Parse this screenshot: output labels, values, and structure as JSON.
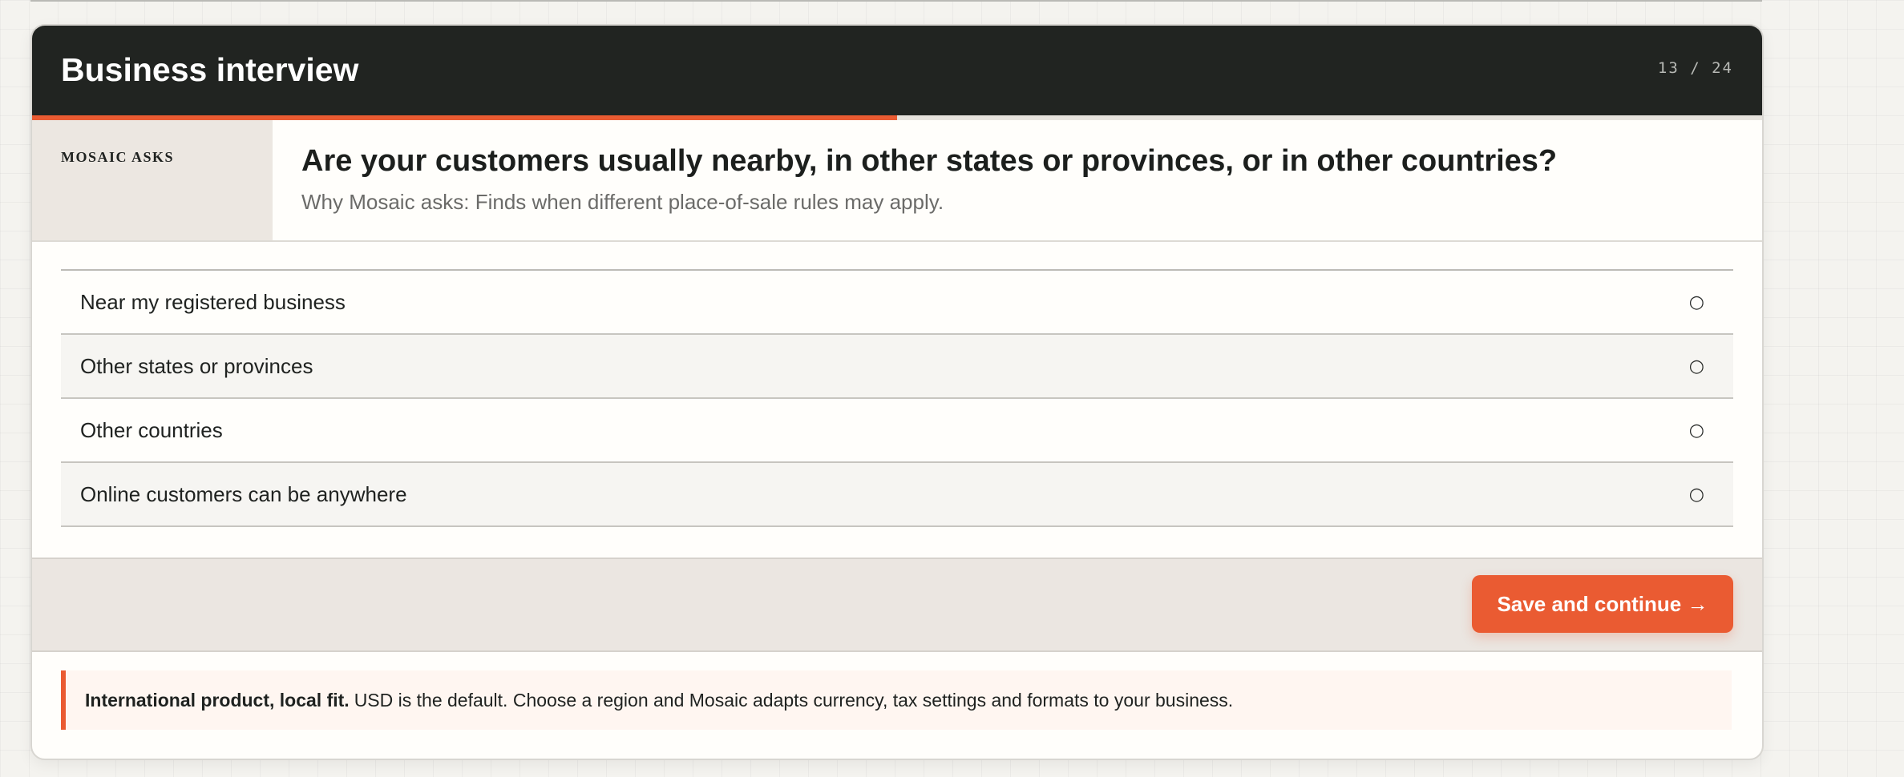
{
  "header": {
    "title": "Business interview",
    "progress_text": "13 / 24",
    "progress_fraction": 0.5
  },
  "question": {
    "asker_label": "MOSAIC ASKS",
    "text": "Are your customers usually nearby, in other states or provinces, or in other countries?",
    "why": "Why Mosaic asks: Finds when different place-of-sale rules may apply."
  },
  "options": [
    {
      "label": "Near my registered business",
      "radio": "○"
    },
    {
      "label": "Other states or provinces",
      "radio": "○"
    },
    {
      "label": "Other countries",
      "radio": "○"
    },
    {
      "label": "Online customers can be anywhere",
      "radio": "○"
    }
  ],
  "actions": {
    "continue_label": "Save and continue →"
  },
  "note": {
    "strong": "International product, local fit.",
    "text": "USD is the default. Choose a region and Mosaic adapts currency, tax settings and formats to your business."
  },
  "colors": {
    "accent": "#ea5b32",
    "header_bg": "#212421"
  }
}
